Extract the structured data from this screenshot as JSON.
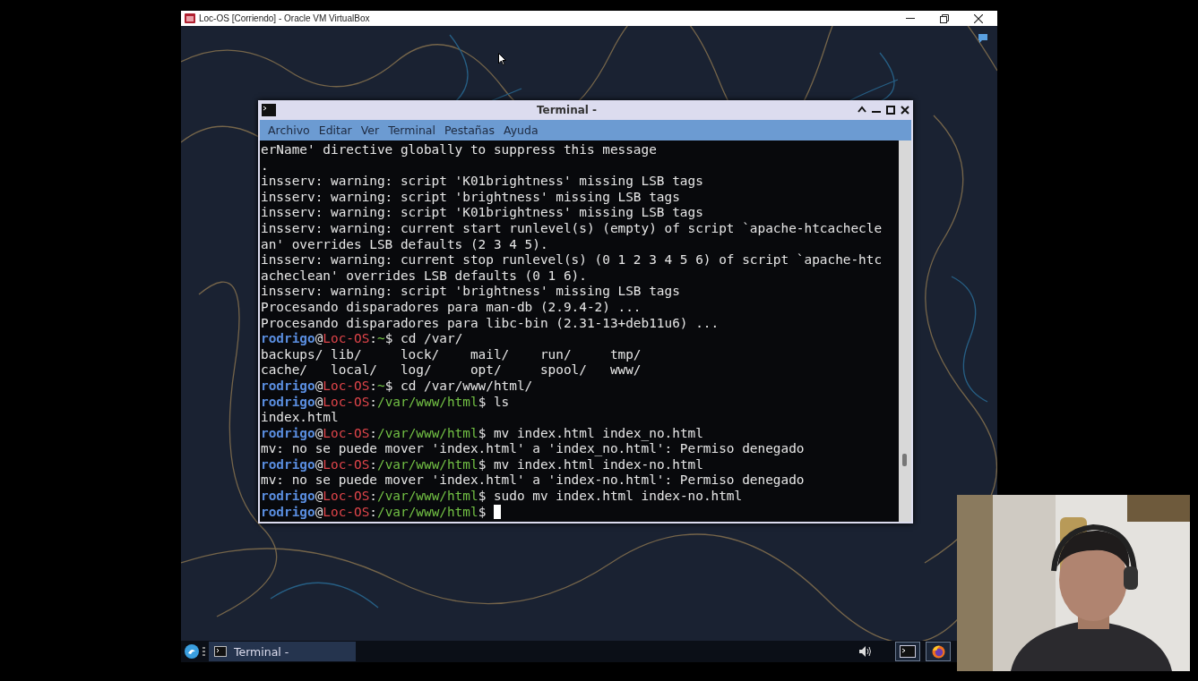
{
  "vbox_window": {
    "title": "Loc-OS [Corriendo] - Oracle VM VirtualBox"
  },
  "terminal": {
    "title": "Terminal -",
    "menu": [
      {
        "label": "Archivo"
      },
      {
        "label": "Editar"
      },
      {
        "label": "Ver"
      },
      {
        "label": "Terminal"
      },
      {
        "label": "Pestañas"
      },
      {
        "label": "Ayuda"
      }
    ],
    "lines": [
      {
        "kind": "text",
        "text": "erName' directive globally to suppress this message"
      },
      {
        "kind": "text",
        "text": "."
      },
      {
        "kind": "text",
        "text": "insserv: warning: script 'K01brightness' missing LSB tags"
      },
      {
        "kind": "text",
        "text": "insserv: warning: script 'brightness' missing LSB tags"
      },
      {
        "kind": "text",
        "text": "insserv: warning: script 'K01brightness' missing LSB tags"
      },
      {
        "kind": "text",
        "text": "insserv: warning: current start runlevel(s) (empty) of script `apache-htcachecle"
      },
      {
        "kind": "text",
        "text": "an' overrides LSB defaults (2 3 4 5)."
      },
      {
        "kind": "text",
        "text": "insserv: warning: current stop runlevel(s) (0 1 2 3 4 5 6) of script `apache-htc"
      },
      {
        "kind": "text",
        "text": "acheclean' overrides LSB defaults (0 1 6)."
      },
      {
        "kind": "text",
        "text": "insserv: warning: script 'brightness' missing LSB tags"
      },
      {
        "kind": "text",
        "text": "Procesando disparadores para man-db (2.9.4-2) ..."
      },
      {
        "kind": "text",
        "text": "Procesando disparadores para libc-bin (2.31-13+deb11u6) ..."
      },
      {
        "kind": "prompt",
        "user": "rodrigo",
        "at": "@",
        "host": "Loc-OS",
        "colon": ":",
        "path": "~",
        "dollar": "$",
        "command": "cd /var/"
      },
      {
        "kind": "text",
        "text": "backups/ lib/     lock/    mail/    run/     tmp/"
      },
      {
        "kind": "text",
        "text": "cache/   local/   log/     opt/     spool/   www/"
      },
      {
        "kind": "prompt",
        "user": "rodrigo",
        "at": "@",
        "host": "Loc-OS",
        "colon": ":",
        "path": "~",
        "dollar": "$",
        "command": "cd /var/www/html/"
      },
      {
        "kind": "prompt",
        "user": "rodrigo",
        "at": "@",
        "host": "Loc-OS",
        "colon": ":",
        "path": "/var/www/html",
        "dollar": "$",
        "command": "ls"
      },
      {
        "kind": "text",
        "text": "index.html"
      },
      {
        "kind": "prompt",
        "user": "rodrigo",
        "at": "@",
        "host": "Loc-OS",
        "colon": ":",
        "path": "/var/www/html",
        "dollar": "$",
        "command": "mv index.html index_no.html"
      },
      {
        "kind": "text",
        "text": "mv: no se puede mover 'index.html' a 'index_no.html': Permiso denegado"
      },
      {
        "kind": "prompt",
        "user": "rodrigo",
        "at": "@",
        "host": "Loc-OS",
        "colon": ":",
        "path": "/var/www/html",
        "dollar": "$",
        "command": "mv index.html index-no.html"
      },
      {
        "kind": "text",
        "text": "mv: no se puede mover 'index.html' a 'index-no.html': Permiso denegado"
      },
      {
        "kind": "prompt",
        "user": "rodrigo",
        "at": "@",
        "host": "Loc-OS",
        "colon": ":",
        "path": "/var/www/html",
        "dollar": "$",
        "command": "sudo mv index.html index-no.html"
      },
      {
        "kind": "prompt",
        "user": "rodrigo",
        "at": "@",
        "host": "Loc-OS",
        "colon": ":",
        "path": "/var/www/html",
        "dollar": "$",
        "cursor": true
      }
    ]
  },
  "taskbar": {
    "tasks": [
      {
        "label": "Terminal -",
        "selected": true
      }
    ]
  }
}
